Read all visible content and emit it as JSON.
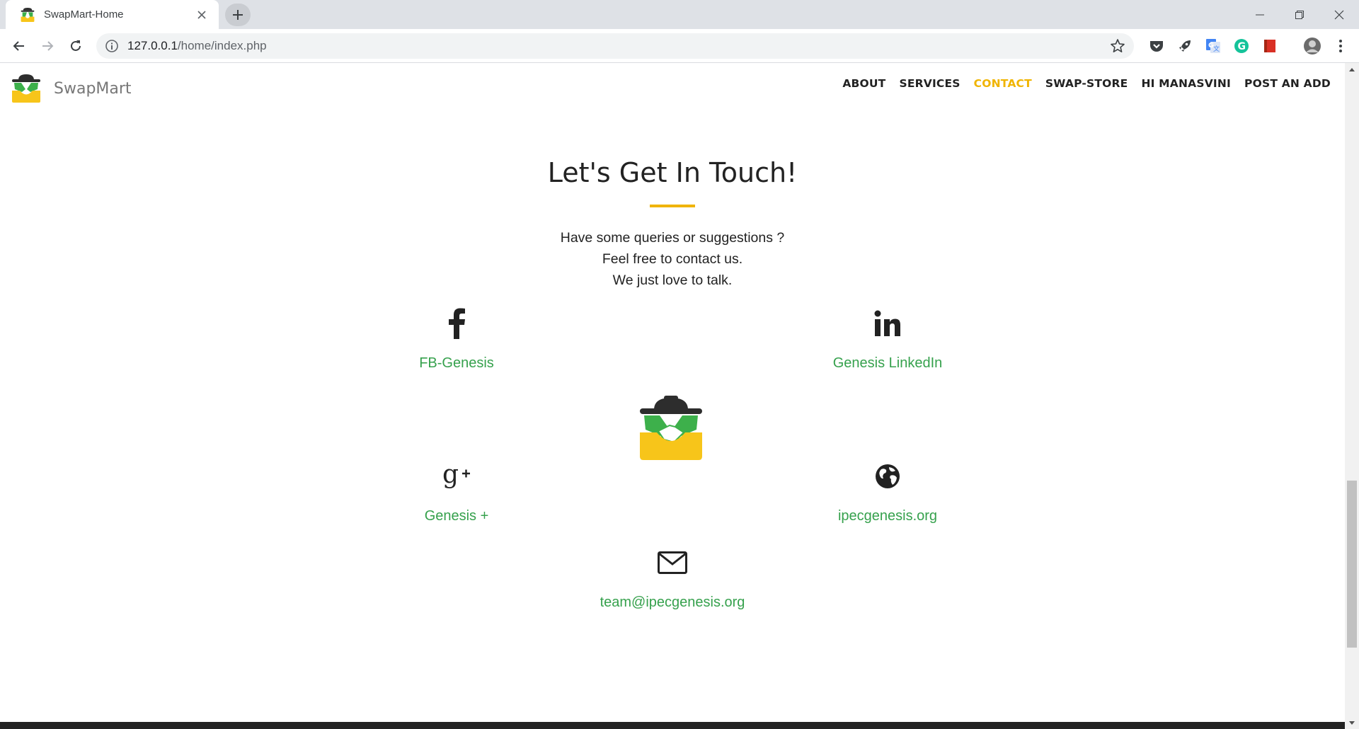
{
  "browser": {
    "tab_title": "SwapMart-Home",
    "url_host": "127.0.0.1",
    "url_path": "/home/index.php"
  },
  "site": {
    "brand": "SwapMart",
    "menu": [
      {
        "label": "ABOUT",
        "active": false
      },
      {
        "label": "SERVICES",
        "active": false
      },
      {
        "label": "CONTACT",
        "active": true
      },
      {
        "label": "SWAP-STORE",
        "active": false
      },
      {
        "label": "HI MANASVINI",
        "active": false
      },
      {
        "label": "POST AN ADD",
        "active": false
      }
    ]
  },
  "contact": {
    "heading": "Let's Get In Touch!",
    "lead": [
      "Have some queries or suggestions ?",
      "Feel free to contact us.",
      "We just love to talk."
    ],
    "links": {
      "facebook": {
        "icon": "facebook-icon",
        "label": "FB-Genesis"
      },
      "linkedin": {
        "icon": "linkedin-icon",
        "label": "Genesis LinkedIn"
      },
      "googleplus": {
        "icon": "google-plus-icon",
        "label": "Genesis +"
      },
      "website": {
        "icon": "globe-icon",
        "label": "ipecgenesis.org"
      },
      "email": {
        "icon": "envelope-icon",
        "label": "team@ipecgenesis.org"
      }
    }
  },
  "colors": {
    "accent": "#f0b400",
    "link": "#36a14d",
    "logo_green": "#3db04b",
    "logo_yellow": "#f7c51a",
    "logo_dark": "#2d2d2d"
  }
}
